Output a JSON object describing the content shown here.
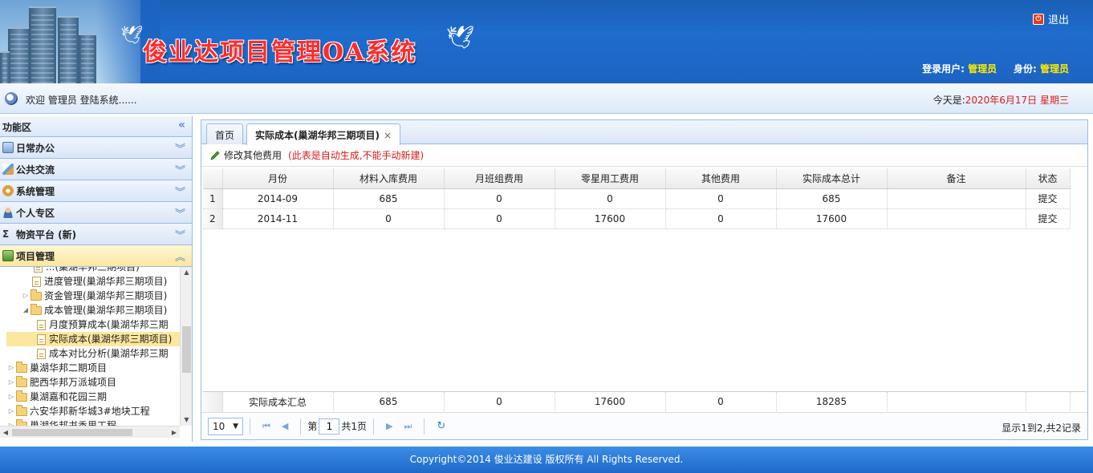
{
  "header": {
    "title": "俊业达项目管理OA系统",
    "logout_label": "退出",
    "login_user_label": "登录用户:",
    "login_user_value": "管理员",
    "role_label": "身份:",
    "role_value": "管理员"
  },
  "welcome": {
    "text": "欢迎 管理员 登陆系统......",
    "date_prefix": "今天是:",
    "date_value": "2020年6月17日 星期三"
  },
  "sidebar": {
    "title": "功能区",
    "sections": [
      {
        "label": "日常办公"
      },
      {
        "label": "公共交流"
      },
      {
        "label": "系统管理"
      },
      {
        "label": "个人专区"
      },
      {
        "label": "物资平台 (新)"
      },
      {
        "label": "项目管理"
      }
    ],
    "tree": [
      {
        "label": "进度管理(巢湖华邦三期项目)"
      },
      {
        "label": "资金管理(巢湖华邦三期项目)"
      },
      {
        "label": "成本管理(巢湖华邦三期项目)"
      },
      {
        "label": "月度预算成本(巢湖华邦三期"
      },
      {
        "label": "实际成本(巢湖华邦三期项目)"
      },
      {
        "label": "成本对比分析(巢湖华邦三期"
      },
      {
        "label": "巢湖华邦二期项目"
      },
      {
        "label": "肥西华邦万派城项目"
      },
      {
        "label": "巢湖嘉和花园三期"
      },
      {
        "label": "六安华邦新华城3#地块工程"
      },
      {
        "label": "巢湖华邦书香里工程"
      }
    ]
  },
  "tabs": [
    {
      "label": "首页"
    },
    {
      "label": "实际成本(巢湖华邦三期项目)"
    }
  ],
  "toolbar": {
    "edit_label": "修改其他费用",
    "note": "(此表是自动生成,不能手动新建)"
  },
  "table": {
    "columns": [
      "月份",
      "材料入库费用",
      "月班组费用",
      "零星用工费用",
      "其他费用",
      "实际成本总计",
      "备注",
      "状态"
    ],
    "rows": [
      {
        "no": "1",
        "cells": [
          "2014-09",
          "685",
          "0",
          "0",
          "0",
          "685",
          "",
          "提交"
        ]
      },
      {
        "no": "2",
        "cells": [
          "2014-11",
          "0",
          "0",
          "17600",
          "0",
          "17600",
          "",
          "提交"
        ]
      }
    ],
    "footer": [
      "实际成本汇总",
      "685",
      "0",
      "17600",
      "0",
      "18285",
      "",
      ""
    ]
  },
  "pager": {
    "page_size": "10",
    "page_prefix": "第",
    "page_value": "1",
    "page_total": "共1页",
    "info": "显示1到2,共2记录"
  },
  "copyright": "Copyright©2014 俊业达建设 版权所有 All Rights Reserved."
}
